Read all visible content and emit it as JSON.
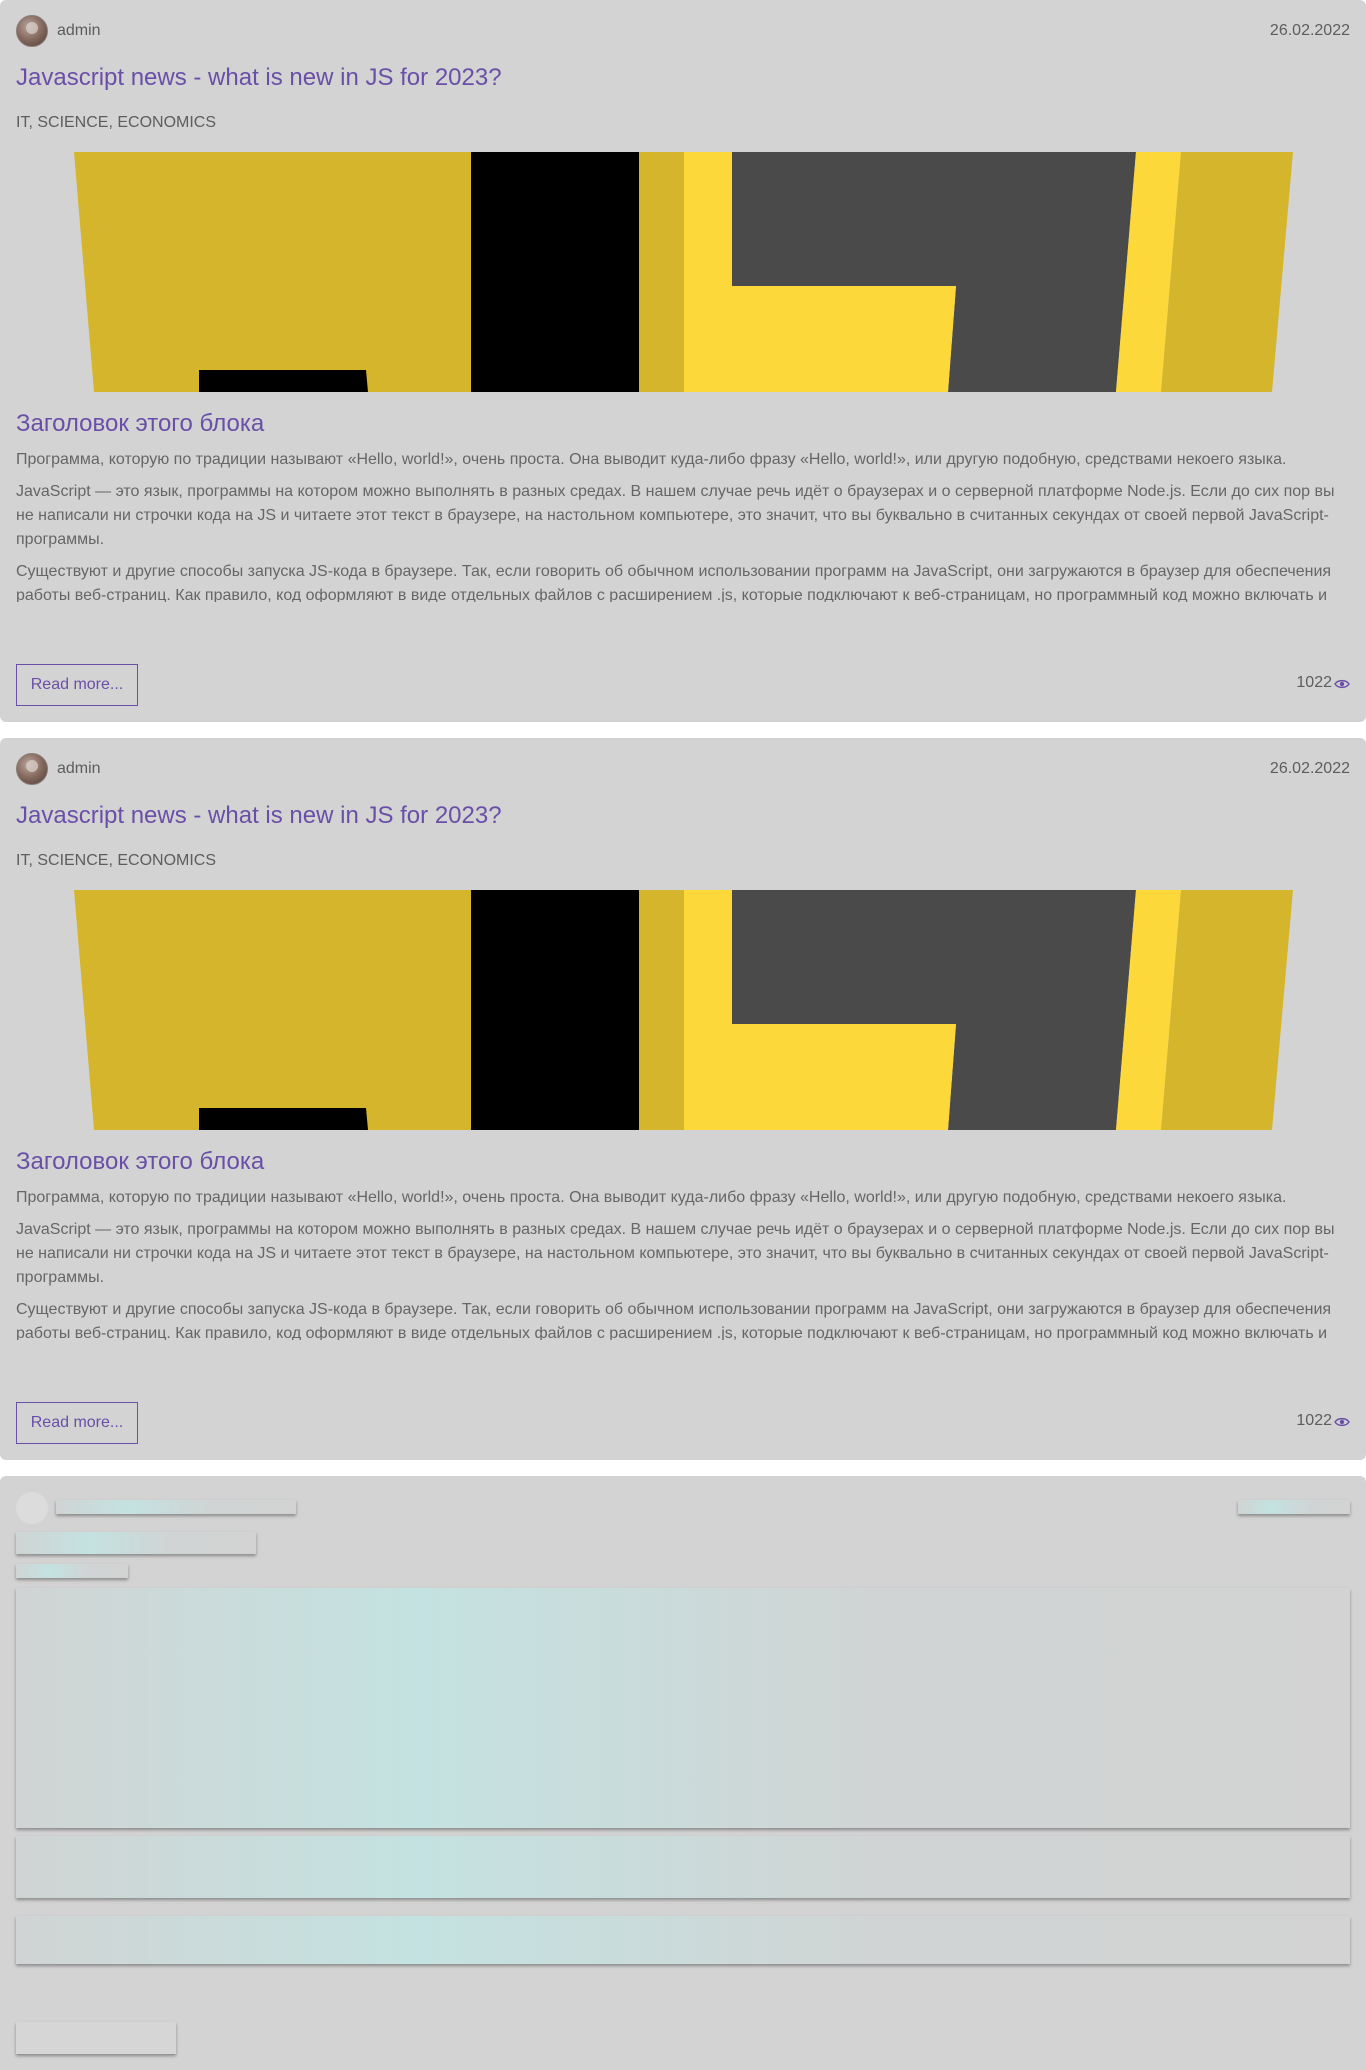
{
  "posts": [
    {
      "author": "admin",
      "date": "26.02.2022",
      "title": "Javascript news - what is new in JS for 2023?",
      "tags": "IT, SCIENCE, ECONOMICS",
      "section_title": "Заголовок этого блока",
      "paragraphs": [
        "Программа, которую по традиции называют «Hello, world!», очень проста. Она выводит куда-либо фразу «Hello, world!», или другую подобную, средствами некоего языка.",
        "JavaScript — это язык, программы на котором можно выполнять в разных средах. В нашем случае речь идёт о браузерах и о серверной платформе Node.js. Если до сих пор вы не написали ни строчки кода на JS и читаете этот текст в браузере, на настольном компьютере, это значит, что вы буквально в считанных секундах от своей первой JavaScript-программы.",
        "Существуют и другие способы запуска JS-кода в браузере. Так, если говорить об обычном использовании программ на JavaScript, они загружаются в браузер для обеспечения работы веб-страниц. Как правило, код оформляют в виде отдельных файлов с расширением .js, которые подключают к веб-страницам, но программный код можно включать и"
      ],
      "read_more_label": "Read more...",
      "views": "1022",
      "view_icon": "eye-icon"
    },
    {
      "author": "admin",
      "date": "26.02.2022",
      "title": "Javascript news - what is new in JS for 2023?",
      "tags": "IT, SCIENCE, ECONOMICS",
      "section_title": "Заголовок этого блока",
      "paragraphs": [
        "Программа, которую по традиции называют «Hello, world!», очень проста. Она выводит куда-либо фразу «Hello, world!», или другую подобную, средствами некоего языка.",
        "JavaScript — это язык, программы на котором можно выполнять в разных средах. В нашем случае речь идёт о браузерах и о серверной платформе Node.js. Если до сих пор вы не написали ни строчки кода на JS и читаете этот текст в браузере, на настольном компьютере, это значит, что вы буквально в считанных секундах от своей первой JavaScript-программы.",
        "Существуют и другие способы запуска JS-кода в браузере. Так, если говорить об обычном использовании программ на JavaScript, они загружаются в браузер для обеспечения работы веб-страниц. Как правило, код оформляют в виде отдельных файлов с расширением .js, которые подключают к веб-страницам, но программный код можно включать и"
      ],
      "read_more_label": "Read more...",
      "views": "1022",
      "view_icon": "eye-icon"
    }
  ],
  "colors": {
    "card_bg": "#d3d3d3",
    "accent": "#6a4fa8",
    "text": "#5d5d5d",
    "js_yellow_dark": "#d4b52c",
    "js_yellow": "#fdd83b",
    "js_gray": "#4a4a4a",
    "js_black": "#000000",
    "skeleton_highlight": "#c4e2e1"
  }
}
